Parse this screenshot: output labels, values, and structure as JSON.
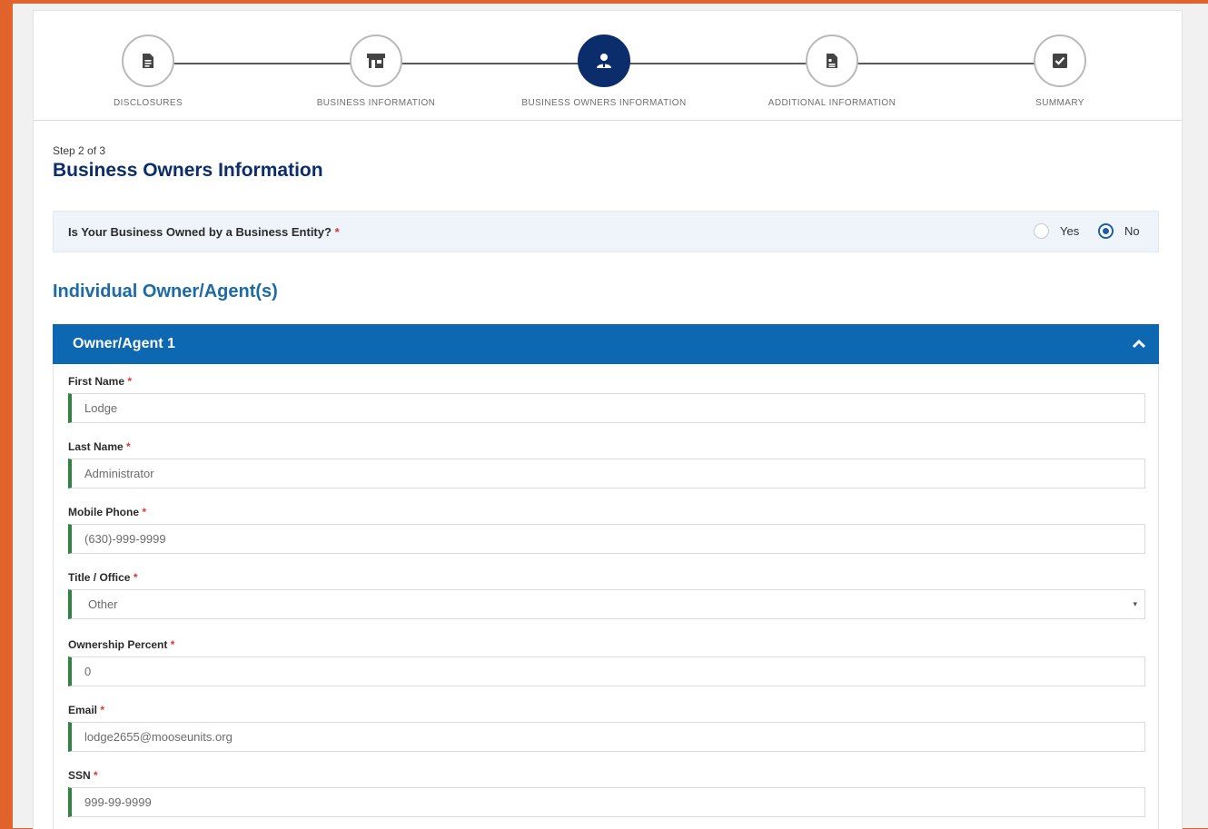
{
  "stepper": {
    "steps": [
      {
        "label": "DISCLOSURES",
        "icon": "document-icon",
        "state": "complete"
      },
      {
        "label": "BUSINESS INFORMATION",
        "icon": "storefront-icon",
        "state": "complete"
      },
      {
        "label": "BUSINESS OWNERS INFORMATION",
        "icon": "person-icon",
        "state": "active"
      },
      {
        "label": "ADDITIONAL INFORMATION",
        "icon": "document-list-icon",
        "state": "incomplete"
      },
      {
        "label": "SUMMARY",
        "icon": "checkbox-icon",
        "state": "incomplete"
      }
    ]
  },
  "page": {
    "step_counter": "Step 2 of 3",
    "title": "Business Owners Information"
  },
  "business_entity_question": {
    "label": "Is Your Business Owned by a Business Entity?",
    "required_mark": "*",
    "options": [
      {
        "label": "Yes",
        "selected": false
      },
      {
        "label": "No",
        "selected": true
      }
    ]
  },
  "owners_section": {
    "title": "Individual Owner/Agent(s)"
  },
  "owner_1": {
    "header": "Owner/Agent 1",
    "fields": [
      {
        "label": "First Name",
        "value": "Lodge"
      },
      {
        "label": "Last Name",
        "value": "Administrator"
      },
      {
        "label": "Mobile Phone",
        "value": "(630)-999-9999"
      },
      {
        "label": "Title / Office",
        "value": "Other"
      },
      {
        "label": "Ownership Percent",
        "value": "0"
      },
      {
        "label": "Email",
        "value": "lodge2655@mooseunits.org"
      },
      {
        "label": "SSN",
        "value": "999-99-9999"
      }
    ],
    "required_mark": "*",
    "select_arrow": "▾"
  },
  "colors": {
    "accent_orange": "#e0632b",
    "navy": "#0b2d6b",
    "accordion_blue": "#0d68b1",
    "section_blue": "#1c6aa6",
    "valid_green": "#2e8540",
    "required_red": "#d83933"
  }
}
